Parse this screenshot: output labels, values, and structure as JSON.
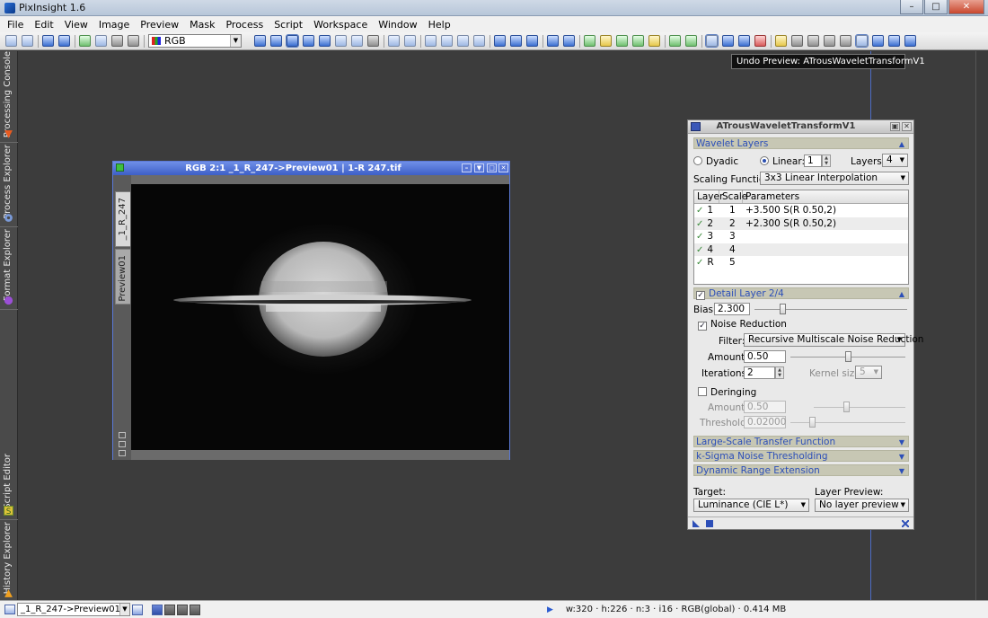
{
  "app": {
    "title": "PixInsight 1.6"
  },
  "menu": [
    "File",
    "Edit",
    "View",
    "Image",
    "Preview",
    "Mask",
    "Process",
    "Script",
    "Workspace",
    "Window",
    "Help"
  ],
  "toolbar": {
    "color_space": "RGB"
  },
  "tooltip": "Undo Preview: ATrousWaveletTransformV1",
  "side_tabs": {
    "processing_console": "Processing Console",
    "process_explorer": "Process Explorer",
    "format_explorer": "Format Explorer",
    "script_editor": "Script Editor",
    "history_explorer": "History Explorer"
  },
  "image_window": {
    "title": "RGB 2:1 _1_R_247->Preview01 | 1-R 247.tif",
    "tabs": [
      "_1_R_247",
      "Preview01"
    ]
  },
  "process": {
    "title": "ATrousWaveletTransformV1",
    "wavelet_layers": {
      "header": "Wavelet Layers",
      "dyadic_label": "Dyadic",
      "linear_label": "Linear:",
      "linear_value": "1",
      "layers_label": "Layers:",
      "layers_value": "4",
      "scaling_label": "Scaling Function:",
      "scaling_value": "3x3 Linear Interpolation",
      "columns": [
        "Layer",
        "Scale",
        "Parameters"
      ],
      "rows": [
        {
          "layer": "1",
          "scale": "1",
          "params": "+3.500 S(R 0.50,2)"
        },
        {
          "layer": "2",
          "scale": "2",
          "params": "+2.300 S(R 0.50,2)"
        },
        {
          "layer": "3",
          "scale": "3",
          "params": ""
        },
        {
          "layer": "4",
          "scale": "4",
          "params": ""
        },
        {
          "layer": "R",
          "scale": "5",
          "params": ""
        }
      ]
    },
    "detail_layer": {
      "header": "Detail Layer 2/4",
      "bias_label": "Bias:",
      "bias_value": "2.300",
      "noise_reduction_label": "Noise Reduction",
      "filter_label": "Filter:",
      "filter_value": "Recursive Multiscale Noise Reduction",
      "amount_label": "Amount:",
      "amount_value": "0.50",
      "iterations_label": "Iterations:",
      "iterations_value": "2",
      "kernel_label": "Kernel size:",
      "kernel_value": "5",
      "deringing_label": "Deringing",
      "dr_amount_label": "Amount:",
      "dr_amount_value": "0.50",
      "threshold_label": "Threshold:",
      "threshold_value": "0.02000"
    },
    "collapsed_sections": [
      "Large-Scale Transfer Function",
      "k-Sigma Noise Thresholding",
      "Dynamic Range Extension"
    ],
    "target_label": "Target:",
    "target_value": "Luminance (CIE L*)",
    "layer_preview_label": "Layer Preview:",
    "layer_preview_value": "No layer preview"
  },
  "statusbar": {
    "view": "_1_R_247->Preview01",
    "info": "w:320 · h:226 · n:3 · i16 · RGB(global) · 0.414 MB"
  }
}
